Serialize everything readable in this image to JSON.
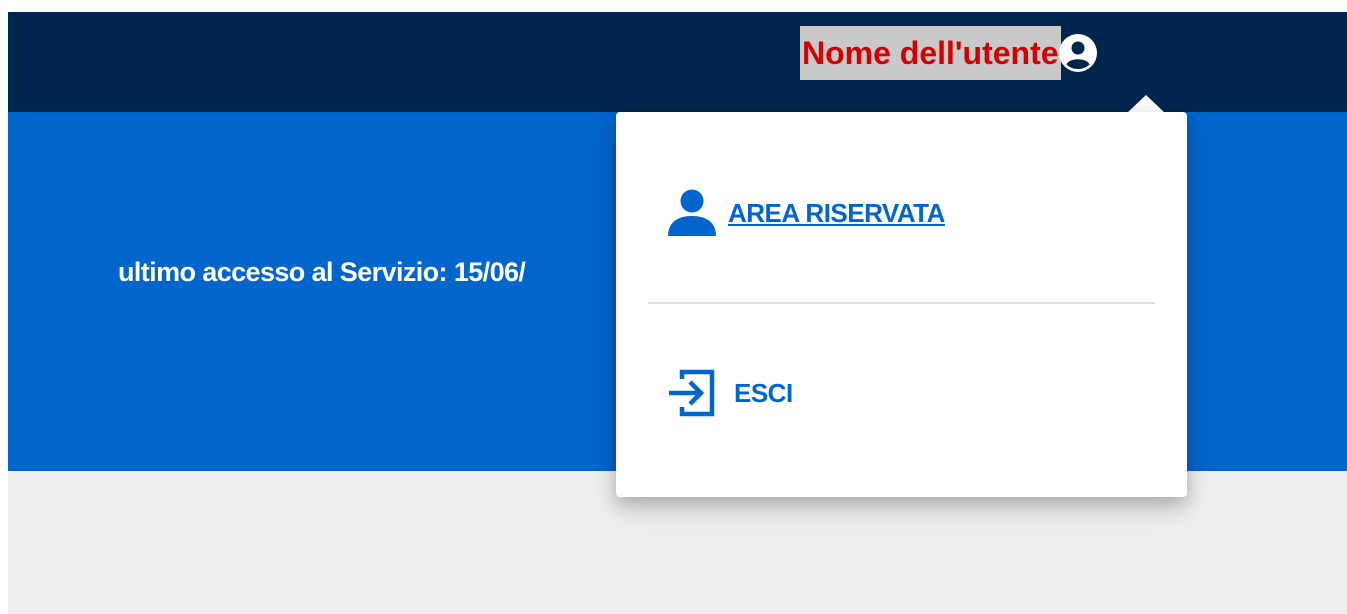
{
  "header": {
    "user_name": "Nome dell'utente",
    "user_icon": "user-circle-icon"
  },
  "hero": {
    "last_access": "ultimo accesso al Servizio:  15/06/"
  },
  "user_menu": {
    "items": [
      {
        "label": "AREA RISERVATA",
        "icon": "person-icon"
      },
      {
        "label": "ESCI",
        "icon": "logout-icon"
      }
    ]
  },
  "colors": {
    "topbar": "#00264d",
    "hero": "#0066cc",
    "accent": "#0066cc",
    "user_name_text": "#d40000",
    "user_name_highlight": "#c9c9c9",
    "page_background": "#efefef"
  }
}
